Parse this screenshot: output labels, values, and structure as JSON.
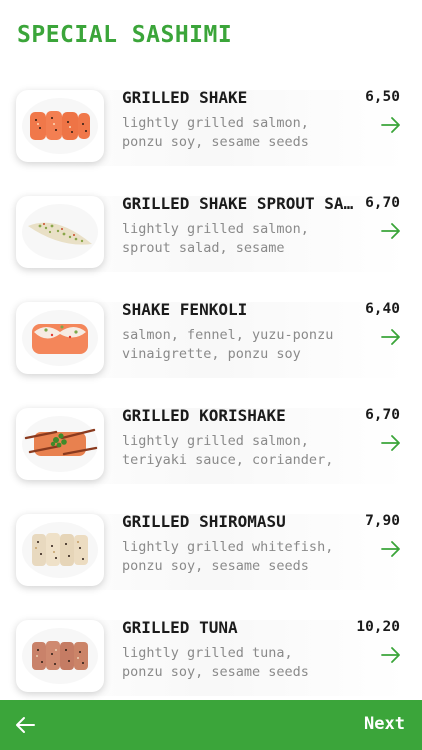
{
  "header": {
    "title": "SPECIAL SASHIMI"
  },
  "items": [
    {
      "name": "GRILLED SHAKE",
      "desc1": "lightly grilled salmon,",
      "desc2": "ponzu soy, sesame seeds",
      "price": "6,50"
    },
    {
      "name": "GRILLED SHAKE SPROUT SALAD",
      "desc1": "lightly grilled salmon,",
      "desc2": "sprout salad, sesame",
      "price": "6,70"
    },
    {
      "name": "SHAKE FENKOLI",
      "desc1": "salmon, fennel, yuzu-ponzu",
      "desc2": "vinaigrette, ponzu soy",
      "price": "6,40"
    },
    {
      "name": "GRILLED KORISHAKE",
      "desc1": "lightly grilled salmon,",
      "desc2": "teriyaki sauce, coriander,",
      "price": "6,70"
    },
    {
      "name": "GRILLED SHIROMASU",
      "desc1": "lightly grilled whitefish,",
      "desc2": "ponzu soy, sesame seeds",
      "price": "7,90"
    },
    {
      "name": "GRILLED TUNA",
      "desc1": "lightly grilled tuna,",
      "desc2": "ponzu soy, sesame seeds",
      "price": "10,20"
    }
  ],
  "footer": {
    "next_label": "Next"
  },
  "colors": {
    "accent": "#3ba53a",
    "text": "#1b1b1b",
    "muted": "#8a8a8a"
  },
  "icons": {
    "item_arrow": "arrow-right-icon",
    "back": "arrow-left-icon"
  }
}
